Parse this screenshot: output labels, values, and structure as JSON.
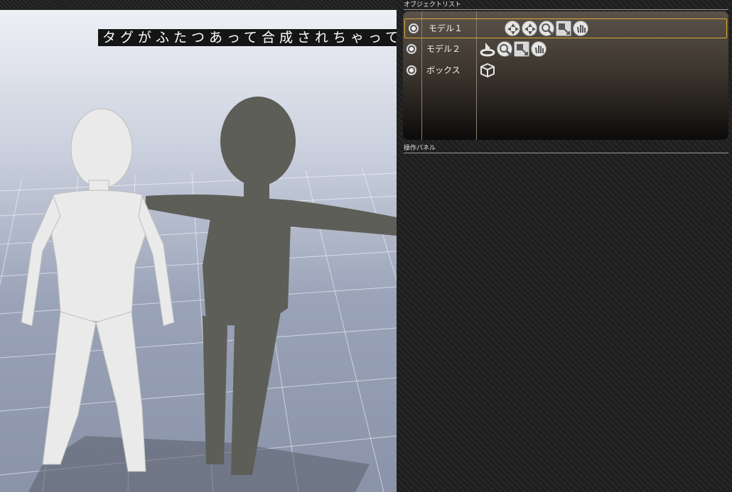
{
  "viewport": {
    "caption": "タグがふたつあって合成されちゃってる→"
  },
  "object_list": {
    "header": "オブジェクトリスト",
    "rows": [
      {
        "label": "モデル１",
        "selected": true,
        "icons": [
          "move-icon",
          "rotate-icon",
          "zoom-icon",
          "resize-icon",
          "hand-icon"
        ]
      },
      {
        "label": "モデル２",
        "selected": false,
        "icons": [
          "pose-icon",
          "zoom-icon",
          "resize-icon",
          "hand-icon"
        ]
      },
      {
        "label": "ボックス",
        "selected": false,
        "icons": [
          "cube-icon"
        ]
      }
    ]
  },
  "operation_panel": {
    "header": "操作パネル"
  },
  "colors": {
    "selected_border": "#d9a93a",
    "caption_bg": "#151515"
  }
}
